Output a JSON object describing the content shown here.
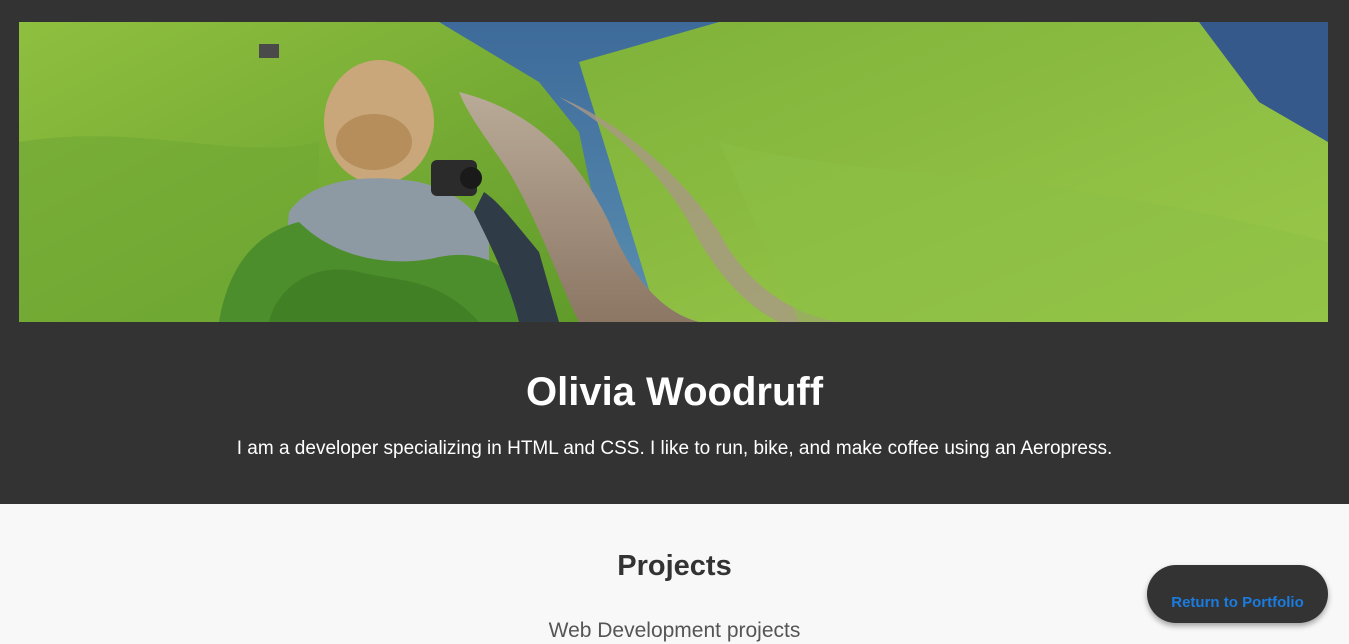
{
  "header": {
    "hero_image": "hiker-photographing-mountain-trail",
    "name": "Olivia Woodruff",
    "bio": "I am a developer specializing in HTML and CSS. I like to run, bike, and make coffee using an Aeropress."
  },
  "projects": {
    "title": "Projects",
    "subtitle": "Web Development projects"
  },
  "return_button": {
    "label": "Return to Portfolio"
  },
  "colors": {
    "header_bg": "#333333",
    "page_bg": "#f8f8f8",
    "link_blue": "#1a7be0"
  }
}
